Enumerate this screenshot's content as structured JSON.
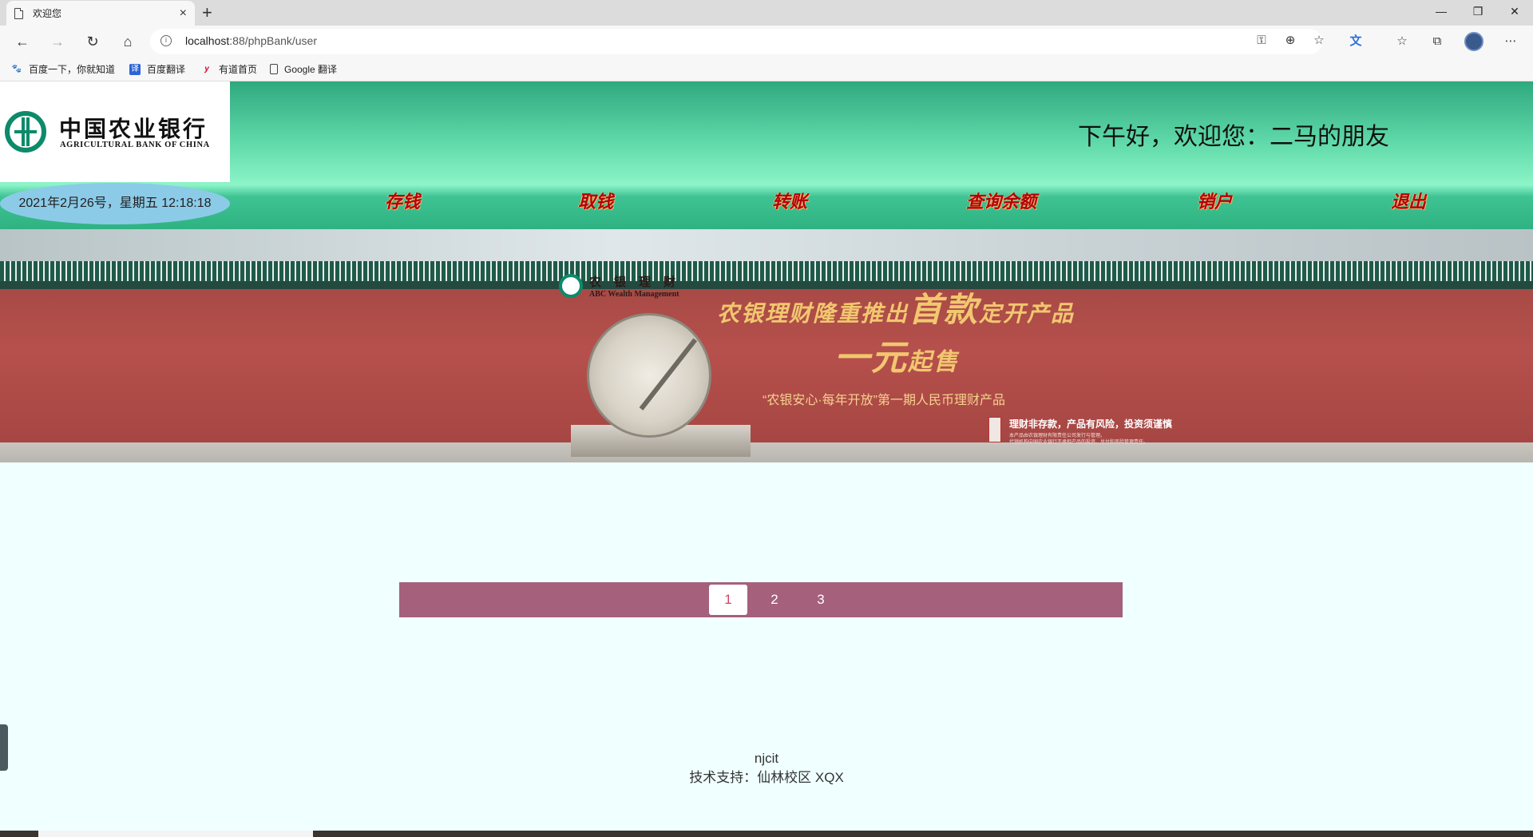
{
  "browser": {
    "tab_title": "欢迎您",
    "tab_close": "×",
    "new_tab": "+",
    "url_host": "localhost",
    "url_path": ":88/phpBank/user",
    "bookmarks": [
      {
        "label": "百度一下，你就知道",
        "icon": "baidu-paw-icon"
      },
      {
        "label": "百度翻译",
        "icon": "baidu-translate-icon"
      },
      {
        "label": "有道首页",
        "icon": "youdao-icon"
      },
      {
        "label": "Google 翻译",
        "icon": "page-icon"
      }
    ]
  },
  "header": {
    "logo_cn": "中国农业银行",
    "logo_en": "AGRICULTURAL BANK OF CHINA",
    "welcome": "下午好，欢迎您：二马的朋友",
    "datetime": "2021年2月26号，星期五 12:18:18"
  },
  "nav": {
    "deposit": "存钱",
    "withdraw": "取钱",
    "transfer": "转账",
    "balance": "查询余额",
    "close_account": "销户",
    "logout": "退出"
  },
  "banner": {
    "brand_cn": "农银理财",
    "brand_en": "ABC Wealth Management",
    "headline_a": "农银理财隆重推出",
    "headline_b": "首款",
    "headline_c": "定开产品",
    "headline2_a": "一元",
    "headline2_b": "起售",
    "subtitle": "“农银安心·每年开放”第一期人民币理财产品",
    "risk": "理财非存款，产品有风险，投资须谨慎",
    "risk_small_1": "本产品由农银理财有限责任公司发行与管理。",
    "risk_small_2": "代销机构中国农业银行不承担产品的投资、兑付和风险管理责任。"
  },
  "pagination": {
    "pages": [
      "1",
      "2",
      "3"
    ],
    "active": "1"
  },
  "footer": {
    "line1": "njcit",
    "line2": "技术支持：仙林校区 XQX"
  },
  "colors": {
    "header_green": "#5ed8a8",
    "nav_text": "#b5000a",
    "pager_bg": "#a5607c",
    "pager_active_text": "#d9406a",
    "page_bg": "#f0ffff"
  }
}
